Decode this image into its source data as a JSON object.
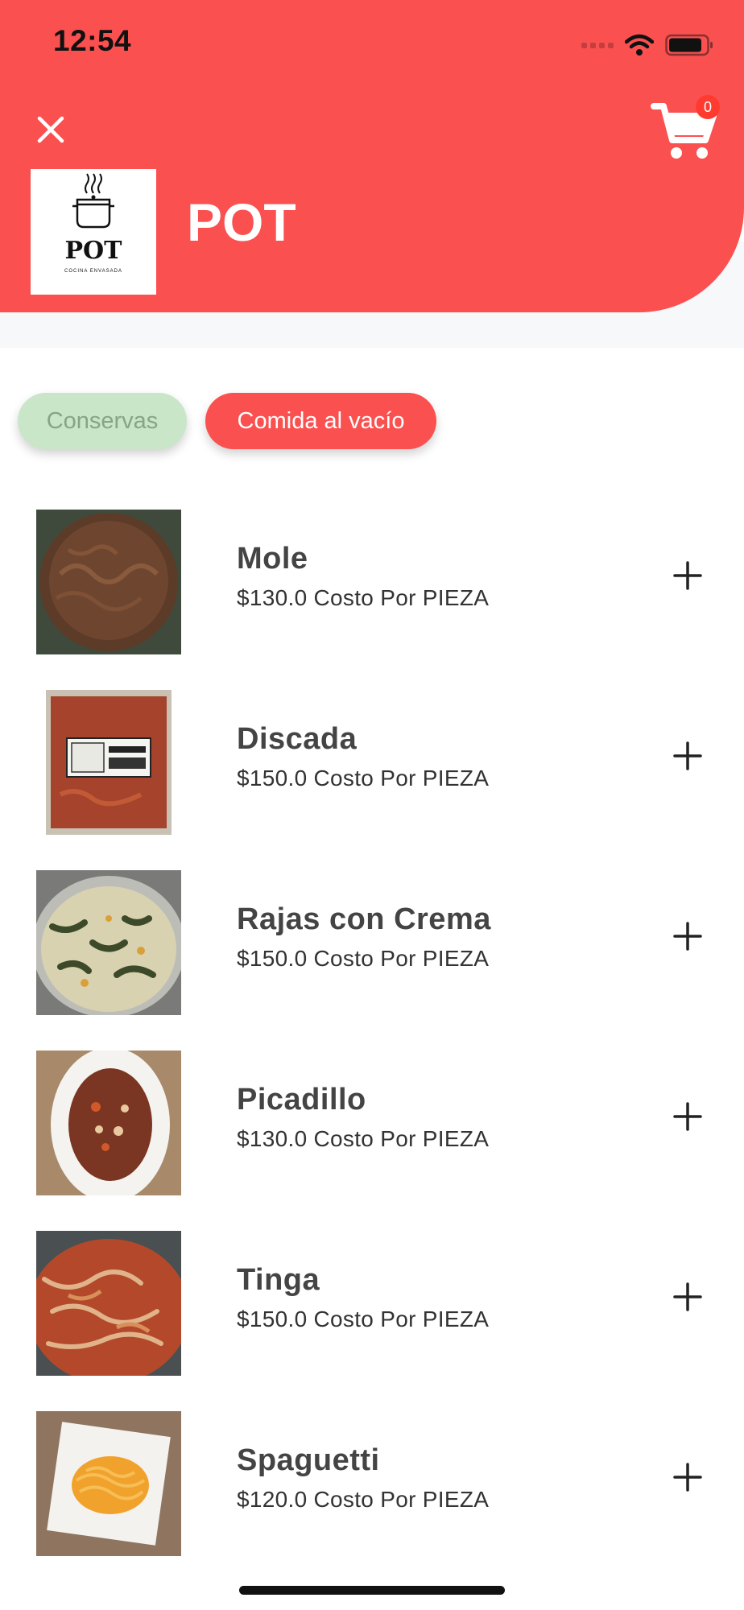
{
  "status_bar": {
    "time": "12:54"
  },
  "header": {
    "shop_name": "POT",
    "logo_text": "POT",
    "logo_subtext": "COCINA ENVASADA",
    "cart_count": "0"
  },
  "colors": {
    "brand": "#fb5050",
    "chip_inactive": "#c9e6c8",
    "chip_inactive_text": "#86a486"
  },
  "categories": [
    {
      "label": "Conservas",
      "selected": false
    },
    {
      "label": "Comida al vacío",
      "selected": true
    }
  ],
  "products": [
    {
      "name": "Mole",
      "price": "$130.0 Costo Por PIEZA"
    },
    {
      "name": "Discada",
      "price": "$150.0 Costo Por PIEZA"
    },
    {
      "name": "Rajas con Crema",
      "price": "$150.0 Costo Por PIEZA"
    },
    {
      "name": "Picadillo",
      "price": "$130.0 Costo Por PIEZA"
    },
    {
      "name": "Tinga",
      "price": "$150.0 Costo Por PIEZA"
    },
    {
      "name": "Spaguetti",
      "price": "$120.0 Costo Por PIEZA"
    }
  ]
}
